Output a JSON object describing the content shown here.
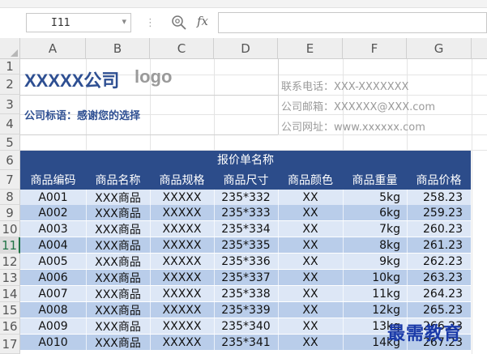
{
  "formula_bar": {
    "name_box": "I11",
    "fx_label": "fx",
    "formula_value": ""
  },
  "columns": [
    "A",
    "B",
    "C",
    "D",
    "E",
    "F",
    "G"
  ],
  "rows": [
    "1",
    "2",
    "3",
    "4",
    "5",
    "6",
    "7",
    "8",
    "9",
    "10",
    "11",
    "12",
    "13",
    "14",
    "15",
    "16",
    "17"
  ],
  "header_block": {
    "company_name": "XXXXX公司",
    "logo_text": "logo",
    "slogan": "公司标语：感谢您的选择",
    "phone": "联系电话：XXX-XXXXXXX",
    "email": "公司邮箱：XXXXXX@XXX.com",
    "website": "公司网址：www.xxxxxx.com"
  },
  "table": {
    "title": "报价单名称",
    "headers": [
      "商品编码",
      "商品名称",
      "商品规格",
      "商品尺寸",
      "商品颜色",
      "商品重量",
      "商品价格"
    ],
    "rows": [
      [
        "A001",
        "XXX商品",
        "XXXXX",
        "235*332",
        "XX",
        "5kg",
        "258.23"
      ],
      [
        "A002",
        "XXX商品",
        "XXXXX",
        "235*333",
        "XX",
        "6kg",
        "259.23"
      ],
      [
        "A003",
        "XXX商品",
        "XXXXX",
        "235*334",
        "XX",
        "7kg",
        "260.23"
      ],
      [
        "A004",
        "XXX商品",
        "XXXXX",
        "235*335",
        "XX",
        "8kg",
        "261.23"
      ],
      [
        "A005",
        "XXX商品",
        "XXXXX",
        "235*336",
        "XX",
        "9kg",
        "262.23"
      ],
      [
        "A006",
        "XXX商品",
        "XXXXX",
        "235*337",
        "XX",
        "10kg",
        "263.23"
      ],
      [
        "A007",
        "XXX商品",
        "XXXXX",
        "235*338",
        "XX",
        "11kg",
        "264.23"
      ],
      [
        "A008",
        "XXX商品",
        "XXXXX",
        "235*339",
        "XX",
        "12kg",
        "265.23"
      ],
      [
        "A009",
        "XXX商品",
        "XXXXX",
        "235*340",
        "XX",
        "13kg",
        "266.23"
      ],
      [
        "A010",
        "XXX商品",
        "XXXXX",
        "235*341",
        "XX",
        "14kg",
        "267.23"
      ]
    ]
  },
  "watermark": "最需教育",
  "colors": {
    "title_band": "#2c4c8a",
    "row_light": "#dde7f6",
    "row_dark": "#b9cdea",
    "company_text": "#2e4f92",
    "active_row_accent": "#217346"
  },
  "icons": {
    "zoom": "zoom-icon",
    "fx": "fx-icon",
    "dropdown": "chevron-down-icon"
  }
}
